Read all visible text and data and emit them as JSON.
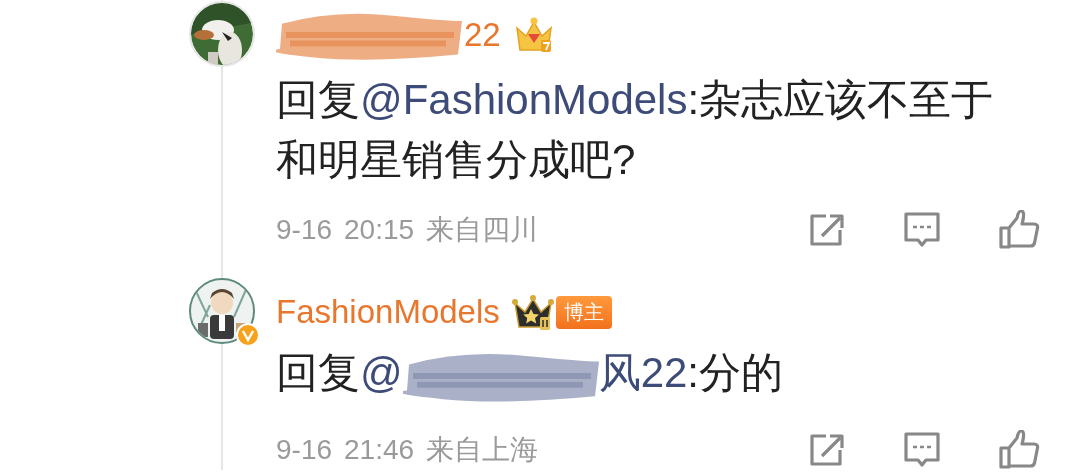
{
  "comments": [
    {
      "verified": false,
      "name_redaction": {
        "color": "#e8915a"
      },
      "username": "22",
      "rank_badge": {
        "kind": "gem-crown"
      },
      "reply": [
        {
          "kind": "text",
          "text": "回复"
        },
        {
          "kind": "mention",
          "text": "@FashionModels"
        },
        {
          "kind": "text",
          "text": ":杂志应该不至于和明星销售分成吧?"
        }
      ],
      "date": "9-16",
      "time": "20:15",
      "location": "来自四川"
    },
    {
      "verified": true,
      "username": "FashionModels",
      "rank_badge": {
        "kind": "star-crown"
      },
      "role_tag": "博主",
      "reply": [
        {
          "kind": "text",
          "text": "回复"
        },
        {
          "kind": "mention",
          "text": "@"
        },
        {
          "kind": "redaction",
          "color": "#8c96b4"
        },
        {
          "kind": "mention",
          "text": "风22"
        },
        {
          "kind": "text",
          "text": ":分的"
        }
      ],
      "date": "9-16",
      "time": "21:46",
      "location": "来自上海"
    }
  ]
}
